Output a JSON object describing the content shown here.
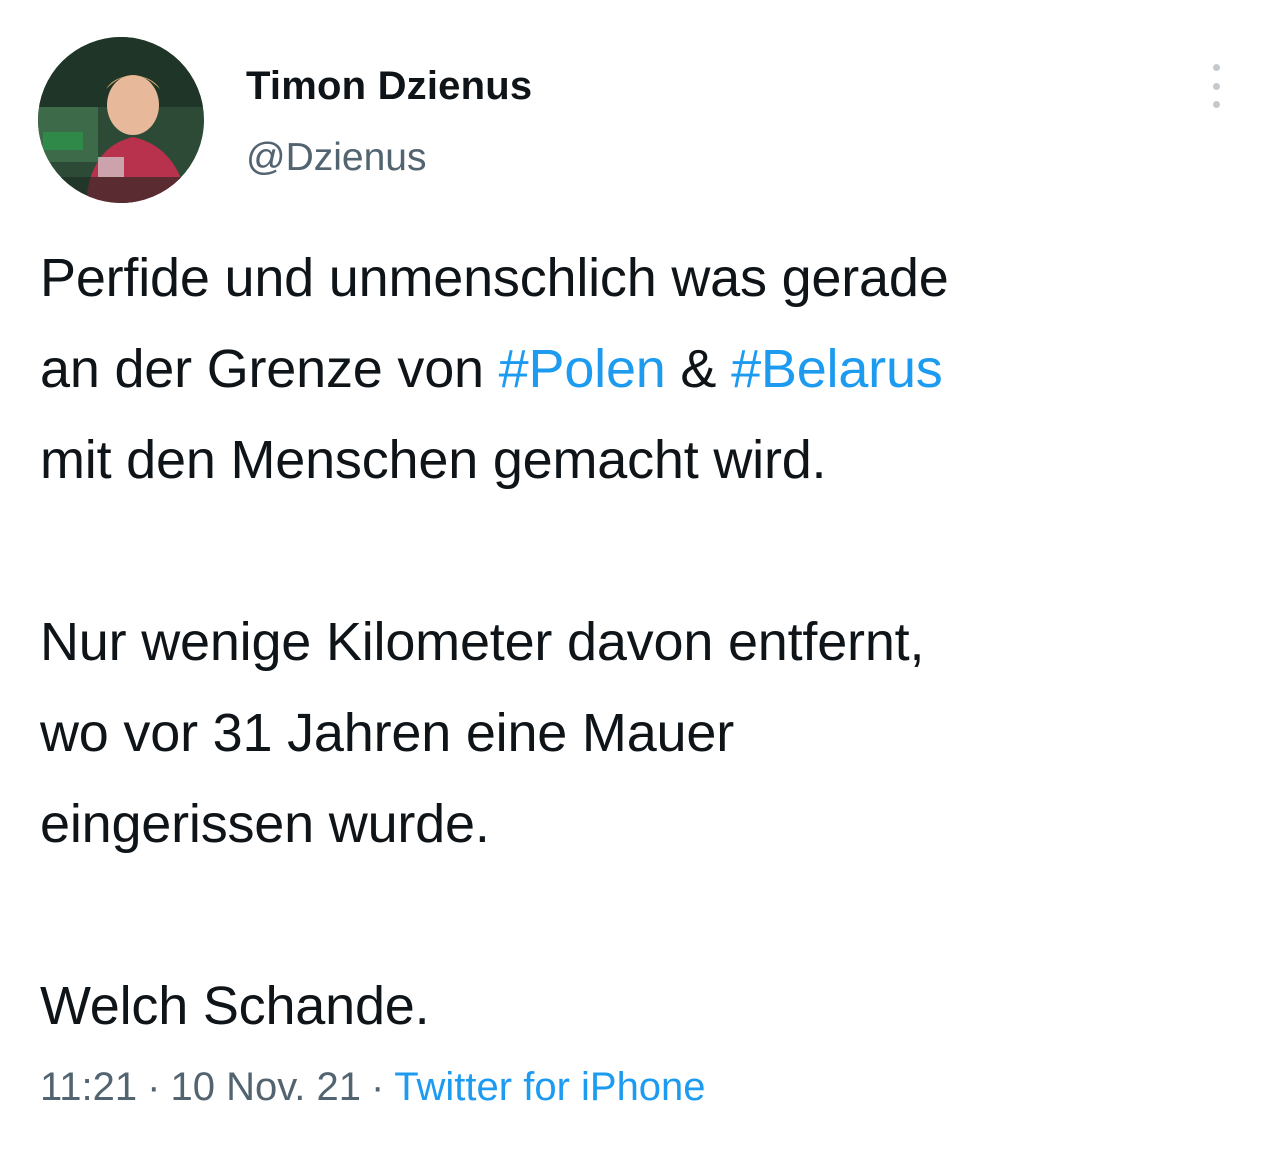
{
  "author": {
    "display_name": "Timon Dzienus",
    "handle": "@Dzienus"
  },
  "avatar": {
    "icon": "profile-photo"
  },
  "menu": {
    "icon": "more-options-icon"
  },
  "tweet": {
    "line1": "Perfide und unmenschlich was gerade",
    "line2_pre": "an der Grenze von ",
    "hashtag_polen": "#Polen",
    "amp": " & ",
    "hashtag_belarus": "#Belarus",
    "line3": "mit den Menschen gemacht wird.",
    "line4": "Nur wenige Kilometer davon entfernt,",
    "line5": "wo vor 31 Jahren eine Mauer",
    "line6": "eingerissen wurde.",
    "line7": "Welch Schande."
  },
  "meta": {
    "time": "11:21",
    "separator": "·",
    "date": "10 Nov. 21",
    "source": "Twitter for iPhone"
  },
  "colors": {
    "text": "#0f1419",
    "secondary": "#536471",
    "link": "#1d9bf0"
  }
}
